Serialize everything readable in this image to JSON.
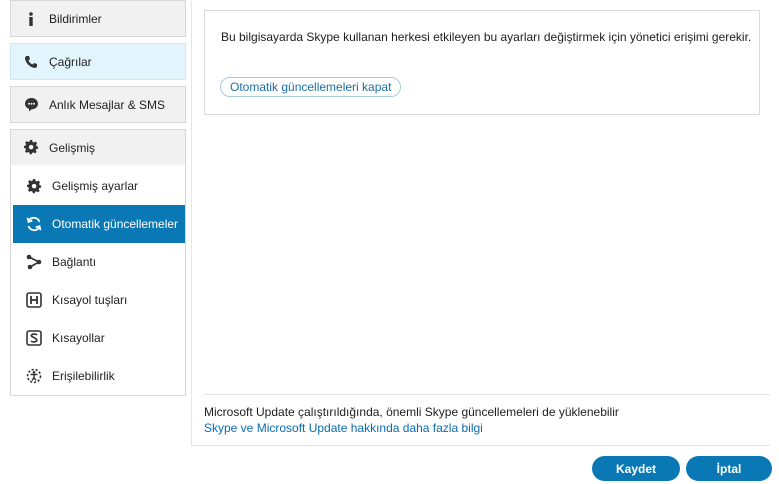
{
  "sidebar": {
    "categories": [
      {
        "label": "Bildirimler",
        "icon": "info-icon"
      },
      {
        "label": "Çağrılar",
        "icon": "phone-icon"
      },
      {
        "label": "Anlık Mesajlar & SMS",
        "icon": "chat-icon"
      },
      {
        "label": "Gelişmiş",
        "icon": "gear-icon"
      }
    ],
    "sub_items": [
      {
        "label": "Gelişmiş ayarlar",
        "icon": "gear-icon"
      },
      {
        "label": "Otomatik güncellemeler",
        "icon": "refresh-icon",
        "active": true
      },
      {
        "label": "Bağlantı",
        "icon": "connection-icon"
      },
      {
        "label": "Kısayol tuşları",
        "icon": "hotkey-h-icon"
      },
      {
        "label": "Kısayollar",
        "icon": "shortcut-s-icon"
      },
      {
        "label": "Erişilebilirlik",
        "icon": "accessibility-icon"
      }
    ]
  },
  "main": {
    "admin_notice": "Bu bilgisayarda Skype kullanan herkesi etkileyen bu ayarları değiştirmek için yönetici erişimi gerekir.",
    "toggle_button_label": "Otomatik güncellemeleri kapat",
    "footer_text": "Microsoft Update çalıştırıldığında, önemli Skype güncellemeleri de yüklenebilir",
    "footer_link": "Skype ve Microsoft Update hakkında daha fazla bilgi"
  },
  "buttons": {
    "save_label": "Kaydet",
    "cancel_label": "İptal"
  },
  "colors": {
    "accent": "#0a78b4",
    "active_category_bg": "#e2f5fd",
    "link": "#0a6bb0"
  }
}
